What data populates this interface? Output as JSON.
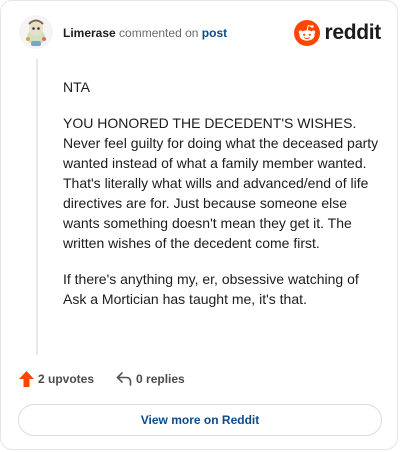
{
  "header": {
    "username": "Limerase",
    "action_text": "commented on",
    "post_link": "post",
    "brand": "reddit"
  },
  "comment": {
    "paragraphs": [
      "NTA",
      "YOU HONORED THE DECEDENT'S WISHES. Never feel guilty for doing what the deceased party wanted instead of what a family member wanted. That's literally what wills and advanced/end of life directives are for. Just because someone else wants something doesn't mean they get it. The written wishes of the decedent come first.",
      "If there's anything my, er, obsessive watching of Ask a Mortician has taught me, it's that."
    ]
  },
  "actions": {
    "upvotes": "2 upvotes",
    "replies": "0 replies"
  },
  "view_more": "View more on Reddit",
  "colors": {
    "upvote": "#ff4500",
    "link": "#0a4a8f",
    "brand": "#ff4500"
  },
  "icons": {
    "upvote": "upvote-arrow-icon",
    "reply": "reply-arrow-icon",
    "brand": "reddit-snoo-icon"
  }
}
